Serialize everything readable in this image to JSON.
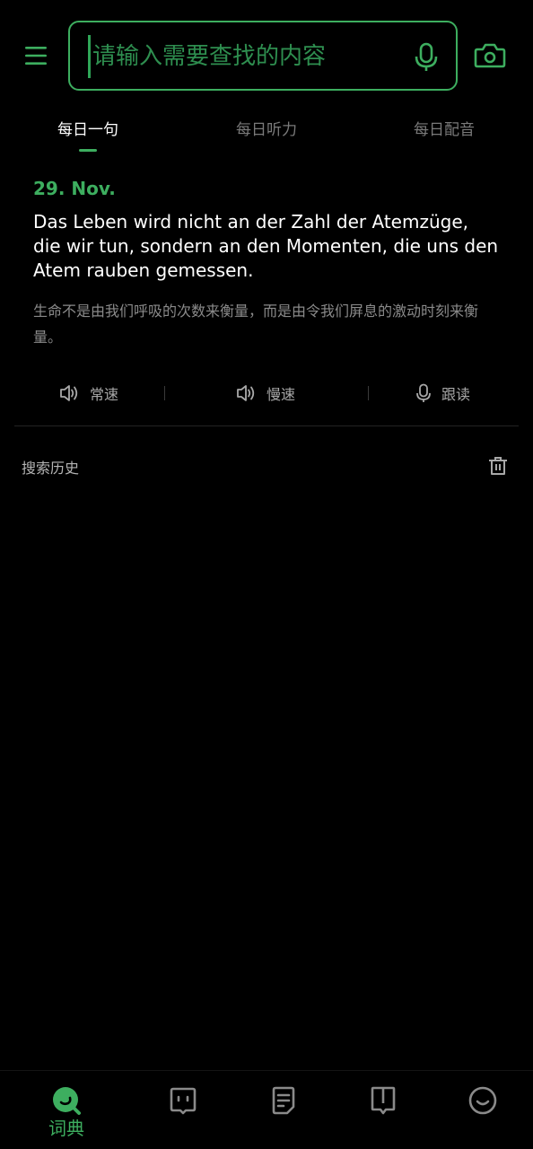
{
  "colors": {
    "accent": "#3dae5f",
    "background": "#000000",
    "muted": "#7a7a7a"
  },
  "search": {
    "placeholder": "请输入需要查找的内容",
    "icons": [
      "menu-icon",
      "mic-icon",
      "camera-icon"
    ]
  },
  "tabs": [
    {
      "label": "每日一句",
      "active": true
    },
    {
      "label": "每日听力",
      "active": false
    },
    {
      "label": "每日配音",
      "active": false
    }
  ],
  "daily": {
    "date": "29. Nov.",
    "sentence": "Das Leben wird nicht an der Zahl der Atemzüge, die wir tun, sondern an den Momenten, die uns den Atem rauben gemessen.",
    "translation": "生命不是由我们呼吸的次数来衡量，而是由令我们屏息的激动时刻来衡量。"
  },
  "actions": [
    {
      "label": "常速",
      "icon": "speaker-icon"
    },
    {
      "label": "慢速",
      "icon": "speaker-icon"
    },
    {
      "label": "跟读",
      "icon": "mic-icon"
    }
  ],
  "history": {
    "title": "搜索历史",
    "icon": "trash-icon"
  },
  "bottom_nav": [
    {
      "label": "词典",
      "icon": "dictionary-icon",
      "active": true
    },
    {
      "label": "",
      "icon": "chat-icon",
      "active": false
    },
    {
      "label": "",
      "icon": "note-icon",
      "active": false
    },
    {
      "label": "",
      "icon": "book-icon",
      "active": false
    },
    {
      "label": "",
      "icon": "smiley-icon",
      "active": false
    }
  ]
}
